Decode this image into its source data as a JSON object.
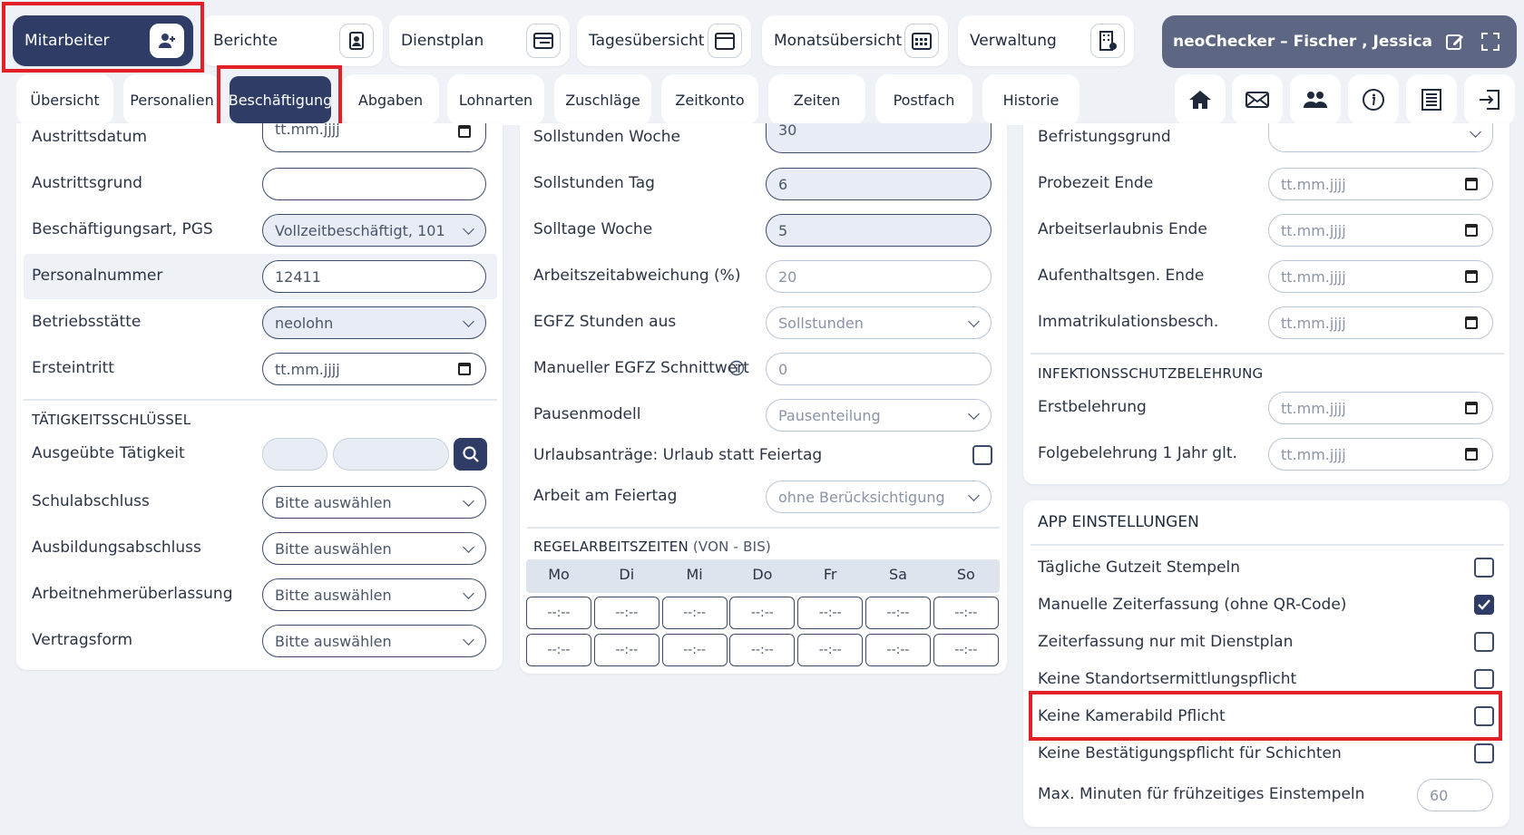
{
  "topnav": {
    "mitarbeiter": "Mitarbeiter",
    "berichte": "Berichte",
    "dienstplan": "Dienstplan",
    "tagesuebersicht": "Tagesübersicht",
    "monatsuebersicht": "Monatsübersicht",
    "verwaltung": "Verwaltung",
    "user": "neoChecker – Fischer , Jessica"
  },
  "subnav": {
    "tabs": [
      "Übersicht",
      "Personalien",
      "Beschäftigung",
      "Abgaben",
      "Lohnarten",
      "Zuschläge",
      "Zeitkonto",
      "Zeiten",
      "Postfach",
      "Historie"
    ],
    "active": "Beschäftigung"
  },
  "left": {
    "austrittsdatum_label": "Austrittsdatum",
    "austrittsdatum_value": "tt.mm.jjjj",
    "austrittsgrund_label": "Austrittsgrund",
    "austrittsgrund_value": "",
    "beschaeftigungsart_label": "Beschäftigungsart, PGS",
    "beschaeftigungsart_value": "Vollzeitbeschäftigt, 101",
    "personalnummer_label": "Personalnummer",
    "personalnummer_value": "12411",
    "betriebsstaette_label": "Betriebsstätte",
    "betriebsstaette_value": "neolohn",
    "ersteintritt_label": "Ersteintritt",
    "ersteintritt_value": "tt.mm.jjjj",
    "taetigkeit_section": "TÄTIGKEITSSCHLÜSSEL",
    "ausgeuebte_label": "Ausgeübte Tätigkeit",
    "schulabschluss_label": "Schulabschluss",
    "schulabschluss_value": "Bitte auswählen",
    "ausbildung_label": "Ausbildungsabschluss",
    "ausbildung_value": "Bitte auswählen",
    "ueberlassung_label": "Arbeitnehmerüberlassung",
    "ueberlassung_value": "Bitte auswählen",
    "vertragsform_label": "Vertragsform",
    "vertragsform_value": "Bitte auswählen"
  },
  "middle": {
    "soll_woche_label": "Sollstunden Woche",
    "soll_woche_value": "30",
    "soll_tag_label": "Sollstunden Tag",
    "soll_tag_value": "6",
    "solltage_label": "Solltage Woche",
    "solltage_value": "5",
    "abweichung_label": "Arbeitszeitabweichung (%)",
    "abweichung_value": "20",
    "egfz_label": "EGFZ Stunden aus",
    "egfz_value": "Sollstunden",
    "egfz_schnitt_label": "Manueller EGFZ Schnittwert",
    "egfz_schnitt_value": "0",
    "pausen_label": "Pausenmodell",
    "pausen_value": "Pausenteilung",
    "urlaub_label": "Urlaubsanträge: Urlaub statt Feiertag",
    "feiertag_label": "Arbeit am Feiertag",
    "feiertag_value": "ohne Berücksichtigung",
    "regel_section": "REGELARBEITSZEITEN",
    "regel_suffix": "(VON - BIS)",
    "days": [
      "Mo",
      "Di",
      "Mi",
      "Do",
      "Fr",
      "Sa",
      "So"
    ],
    "time_placeholder": "--:--"
  },
  "right": {
    "befristung_label": "Befristungsgrund",
    "probezeit_label": "Probezeit Ende",
    "arbeitserlaubnis_label": "Arbeitserlaubnis Ende",
    "aufenthalt_label": "Aufenthaltsgen. Ende",
    "immatrikulation_label": "Immatrikulationsbesch.",
    "date_placeholder": "tt.mm.jjjj",
    "infektion_section": "INFEKTIONSSCHUTZBELEHRUNG",
    "erstbelehrung_label": "Erstbelehrung",
    "folgebelehrung_label": "Folgebelehrung 1 Jahr glt."
  },
  "app": {
    "title": "APP EINSTELLUNGEN",
    "items": [
      {
        "label": "Tägliche Gutzeit Stempeln",
        "checked": false
      },
      {
        "label": "Manuelle Zeiterfassung (ohne QR-Code)",
        "checked": true
      },
      {
        "label": "Zeiterfassung nur mit Dienstplan",
        "checked": false
      },
      {
        "label": "Keine Standortsermittlungspflicht",
        "checked": false
      },
      {
        "label": "Keine Kamerabild Pflicht",
        "checked": false
      },
      {
        "label": "Keine Bestätigungspflicht für Schichten",
        "checked": false
      }
    ],
    "max_label": "Max. Minuten für frühzeitiges Einstempeln",
    "max_value": "60"
  },
  "colors": {
    "primary": "#2f3d66",
    "highlight": "#e32027",
    "background": "#eef2f7"
  }
}
